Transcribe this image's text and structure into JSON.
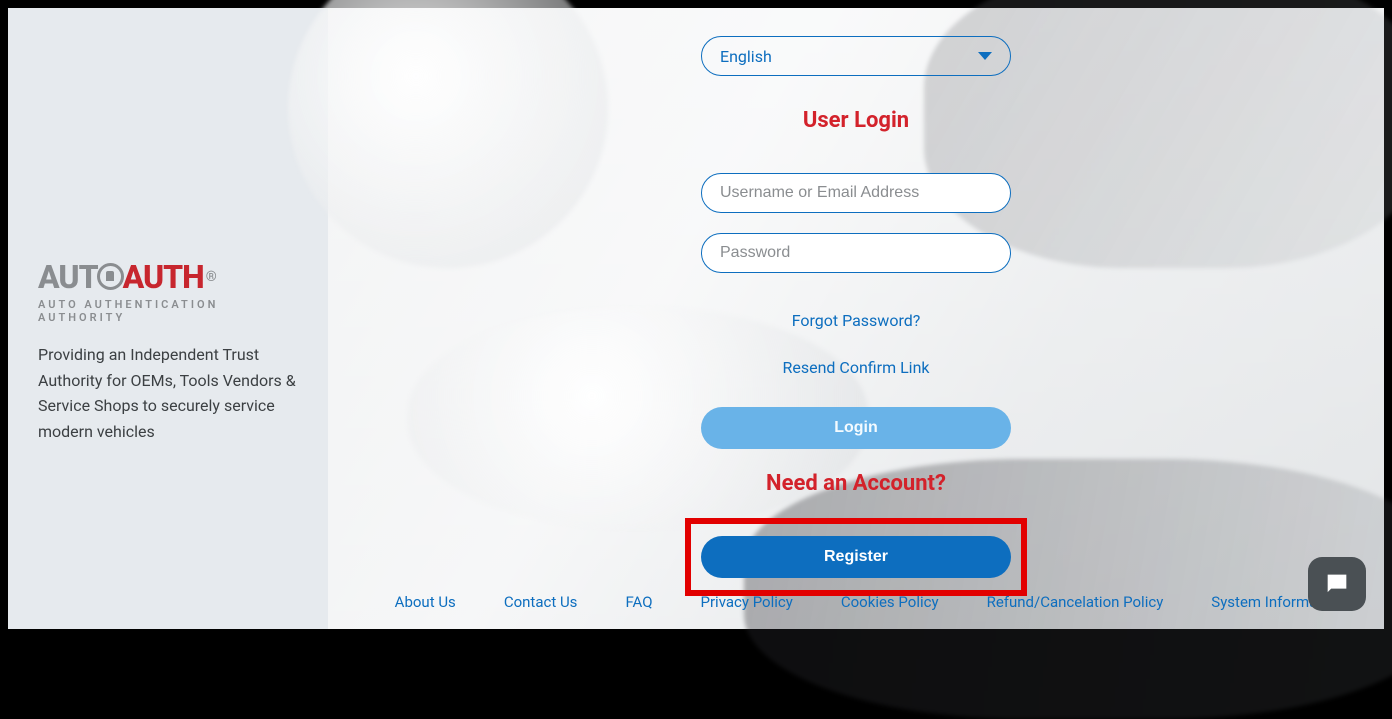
{
  "brand": {
    "name_part1": "AUT",
    "name_part2": "AUTH",
    "registered": "®",
    "subtitle": "AUTO AUTHENTICATION AUTHORITY",
    "tagline": "Providing an Independent Trust Authority for OEMs, Tools Vendors & Service Shops to securely service modern vehicles"
  },
  "language": {
    "selected": "English"
  },
  "login": {
    "heading": "User Login",
    "username_placeholder": "Username or Email Address",
    "password_placeholder": "Password",
    "forgot_link": "Forgot Password?",
    "resend_link": "Resend Confirm Link",
    "login_button": "Login"
  },
  "register": {
    "heading": "Need an Account?",
    "button": "Register"
  },
  "footer": {
    "links": [
      "About Us",
      "Contact Us",
      "FAQ",
      "Privacy Policy",
      "Cookies Policy",
      "Refund/Cancelation Policy",
      "System Informa"
    ]
  }
}
